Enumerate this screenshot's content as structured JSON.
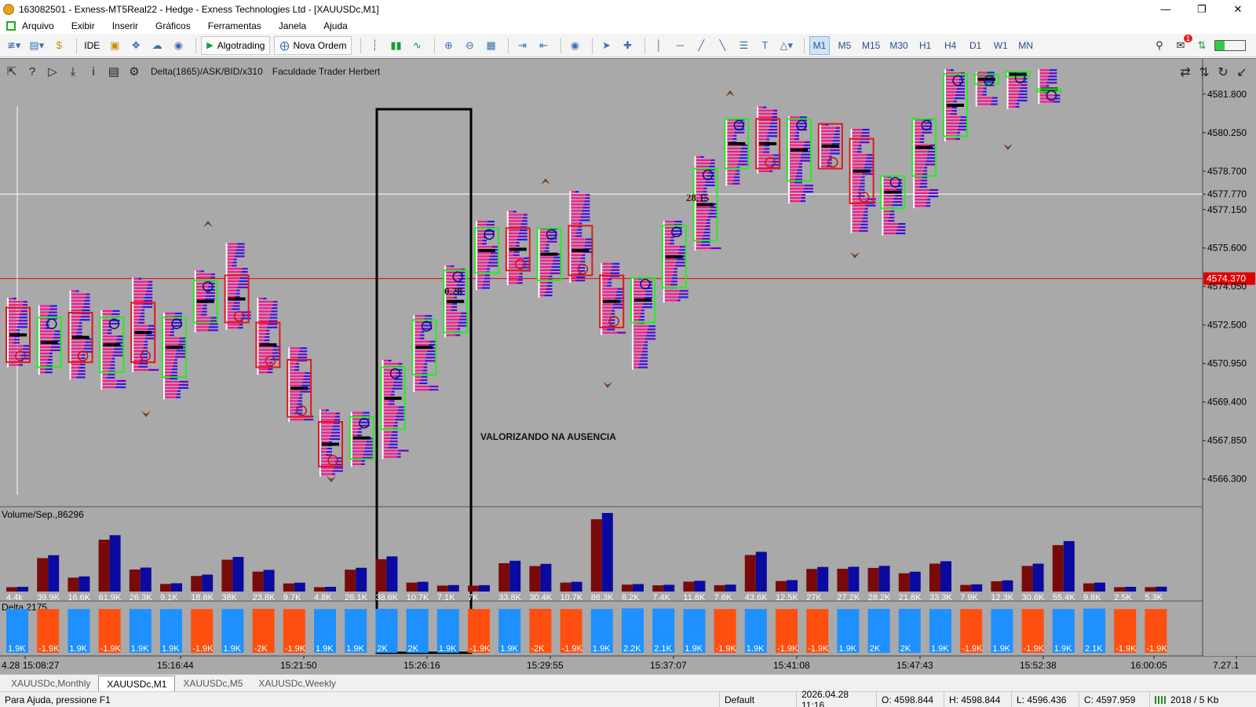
{
  "window": {
    "title": "163082501 - Exness-MT5Real22 - Hedge - Exness Technologies Ltd - [XAUUSDc,M1]"
  },
  "menu": [
    "Arquivo",
    "Exibir",
    "Inserir",
    "Gráficos",
    "Ferramentas",
    "Janela",
    "Ajuda"
  ],
  "toolbar": {
    "ide_label": "IDE",
    "algotrading_label": "Algotrading",
    "nova_ordem_label": "Nova Ordem",
    "timeframes": [
      "M1",
      "M5",
      "M15",
      "M30",
      "H1",
      "H4",
      "D1",
      "W1",
      "MN"
    ],
    "active_timeframe": "M1",
    "notification_count": "1"
  },
  "chart_header": {
    "indicator_label": "Delta(1865)/ASK/BID/x310",
    "teacher_label": "Faculdade Trader Herbert"
  },
  "price_axis": [
    "4581.800",
    "4580.250",
    "4578.700",
    "4577.770",
    "4577.150",
    "4575.600",
    "4574.370",
    "4574.050",
    "4572.500",
    "4570.950",
    "4569.400",
    "4567.850",
    "4566.300"
  ],
  "current_price": "4574.370",
  "crosshair_price": "4577.770",
  "annotations": {
    "text1": "VALORIZANDO NA AUSENCIA",
    "delta1": "0.28",
    "delta2": "28.15"
  },
  "volume_panel": {
    "label": "Volume/Sep.,86296",
    "values": [
      "4.4k",
      "39.9K",
      "16.6K",
      "61.9K",
      "26.3K",
      "9.1K",
      "18.6K",
      "38K",
      "23.8K",
      "9.7K",
      "4.8K",
      "26.1K",
      "38.6K",
      "10.7K",
      "7.1K",
      "7K",
      "33.8K",
      "30.4K",
      "10.7K",
      "86.3K",
      "8.2K",
      "7.4K",
      "11.8K",
      "7.6K",
      "43.6K",
      "12.5K",
      "27K",
      "27.2K",
      "28.2K",
      "21.8K",
      "33.3K",
      "7.9K",
      "12.3K",
      "30.6K",
      "55.4K",
      "9.8K",
      "2.5K",
      "5.3K"
    ]
  },
  "delta_panel": {
    "label": "Delta,2175",
    "values": [
      "1.9K",
      "-1.9K",
      "1.9K",
      "-1.9K",
      "1.9K",
      "1.9K",
      "-1.9K",
      "1.9K",
      "-2K",
      "-1.9K",
      "1.9K",
      "1.9K",
      "2K",
      "2K",
      "1.9K",
      "-1.9K",
      "1.9K",
      "-2K",
      "-1.9K",
      "1.9K",
      "2.2K",
      "2.1K",
      "1.9K",
      "-1.9K",
      "1.9K",
      "-1.9K",
      "-1.9K",
      "1.9K",
      "2K",
      "2K",
      "1.9K",
      "-1.9K",
      "1.9K",
      "-1.9K",
      "1.9K",
      "2.1K",
      "-1.9K",
      "-1.9K"
    ]
  },
  "time_axis": [
    "4.28 15:08:27",
    "15:16:44",
    "15:21:50",
    "15:26:16",
    "15:29:55",
    "15:37:07",
    "15:41:08",
    "15:47:43",
    "15:52:38",
    "16:00:05",
    "7.27.1"
  ],
  "tabs": [
    "XAUUSDc,Monthly",
    "XAUUSDc,M1",
    "XAUUSDc,M5",
    "XAUUSDc,Weekly"
  ],
  "active_tab": "XAUUSDc,M1",
  "status": {
    "help": "Para Ajuda, pressione F1",
    "profile": "Default",
    "datetime": "2026.04.28 11:16",
    "open": "O: 4598.844",
    "high": "H: 4598.844",
    "low": "L: 4596.436",
    "close": "C: 4597.959",
    "traffic": "2018 / 5 Kb"
  },
  "colors": {
    "bull": "#22ee22",
    "bear": "#e01818",
    "vol_dark": "#7a0a0a",
    "vol_blue": "#0a0aa0",
    "delta_pos": "#1e90ff",
    "delta_neg": "#ff4f10",
    "price_line": "#e00000"
  },
  "chart_data": {
    "type": "candlestick",
    "symbol": "XAUUSDc,M1",
    "ylim": [
      4565.5,
      4582.9
    ],
    "candles": [
      {
        "o": 4573.2,
        "c": 4571.0,
        "h": 4573.6,
        "l": 4570.8
      },
      {
        "o": 4570.8,
        "c": 4572.8,
        "h": 4573.3,
        "l": 4570.5
      },
      {
        "o": 4573.0,
        "c": 4571.0,
        "h": 4573.9,
        "l": 4570.3
      },
      {
        "o": 4570.6,
        "c": 4572.8,
        "h": 4573.1,
        "l": 4569.9
      },
      {
        "o": 4573.4,
        "c": 4571.0,
        "h": 4574.4,
        "l": 4570.6
      },
      {
        "o": 4570.4,
        "c": 4572.8,
        "h": 4573.0,
        "l": 4569.5
      },
      {
        "o": 4572.6,
        "c": 4574.3,
        "h": 4574.7,
        "l": 4572.2
      },
      {
        "o": 4574.5,
        "c": 4572.6,
        "h": 4575.8,
        "l": 4572.3
      },
      {
        "o": 4572.6,
        "c": 4570.8,
        "h": 4573.6,
        "l": 4570.5
      },
      {
        "o": 4571.1,
        "c": 4568.8,
        "h": 4571.6,
        "l": 4568.6
      },
      {
        "o": 4568.6,
        "c": 4566.8,
        "h": 4569.1,
        "l": 4566.4
      },
      {
        "o": 4567.1,
        "c": 4568.8,
        "h": 4569.0,
        "l": 4566.8
      },
      {
        "o": 4568.3,
        "c": 4570.8,
        "h": 4571.1,
        "l": 4567.1
      },
      {
        "o": 4570.5,
        "c": 4572.7,
        "h": 4572.9,
        "l": 4569.8
      },
      {
        "o": 4572.2,
        "c": 4574.7,
        "h": 4574.9,
        "l": 4572.0
      },
      {
        "o": 4574.6,
        "c": 4576.4,
        "h": 4576.7,
        "l": 4573.9
      },
      {
        "o": 4576.4,
        "c": 4574.7,
        "h": 4577.1,
        "l": 4574.1
      },
      {
        "o": 4574.3,
        "c": 4576.4,
        "h": 4576.4,
        "l": 4573.6
      },
      {
        "o": 4576.5,
        "c": 4574.5,
        "h": 4577.9,
        "l": 4574.2
      },
      {
        "o": 4574.5,
        "c": 4572.4,
        "h": 4575.0,
        "l": 4572.1
      },
      {
        "o": 4572.6,
        "c": 4574.4,
        "h": 4574.4,
        "l": 4570.7
      },
      {
        "o": 4574.0,
        "c": 4576.5,
        "h": 4576.7,
        "l": 4573.4
      },
      {
        "o": 4575.9,
        "c": 4578.8,
        "h": 4579.3,
        "l": 4575.5
      },
      {
        "o": 4578.8,
        "c": 4580.8,
        "h": 4580.8,
        "l": 4578.1
      },
      {
        "o": 4580.8,
        "c": 4578.8,
        "h": 4581.3,
        "l": 4578.6
      },
      {
        "o": 4578.3,
        "c": 4580.8,
        "h": 4580.9,
        "l": 4577.4
      },
      {
        "o": 4580.6,
        "c": 4578.8,
        "h": 4580.6,
        "l": 4578.8
      },
      {
        "o": 4580.0,
        "c": 4577.4,
        "h": 4580.4,
        "l": 4576.2
      },
      {
        "o": 4577.2,
        "c": 4578.5,
        "h": 4578.5,
        "l": 4576.1
      },
      {
        "o": 4578.5,
        "c": 4580.8,
        "h": 4580.8,
        "l": 4577.2
      },
      {
        "o": 4580.1,
        "c": 4582.6,
        "h": 4582.8,
        "l": 4579.9
      },
      {
        "o": 4582.2,
        "c": 4582.6,
        "h": 4582.7,
        "l": 4581.3
      },
      {
        "o": 4582.5,
        "c": 4582.7,
        "h": 4582.7,
        "l": 4581.2
      },
      {
        "o": 4582.0,
        "c": 4582.0,
        "h": 4582.8,
        "l": 4581.4
      }
    ]
  }
}
